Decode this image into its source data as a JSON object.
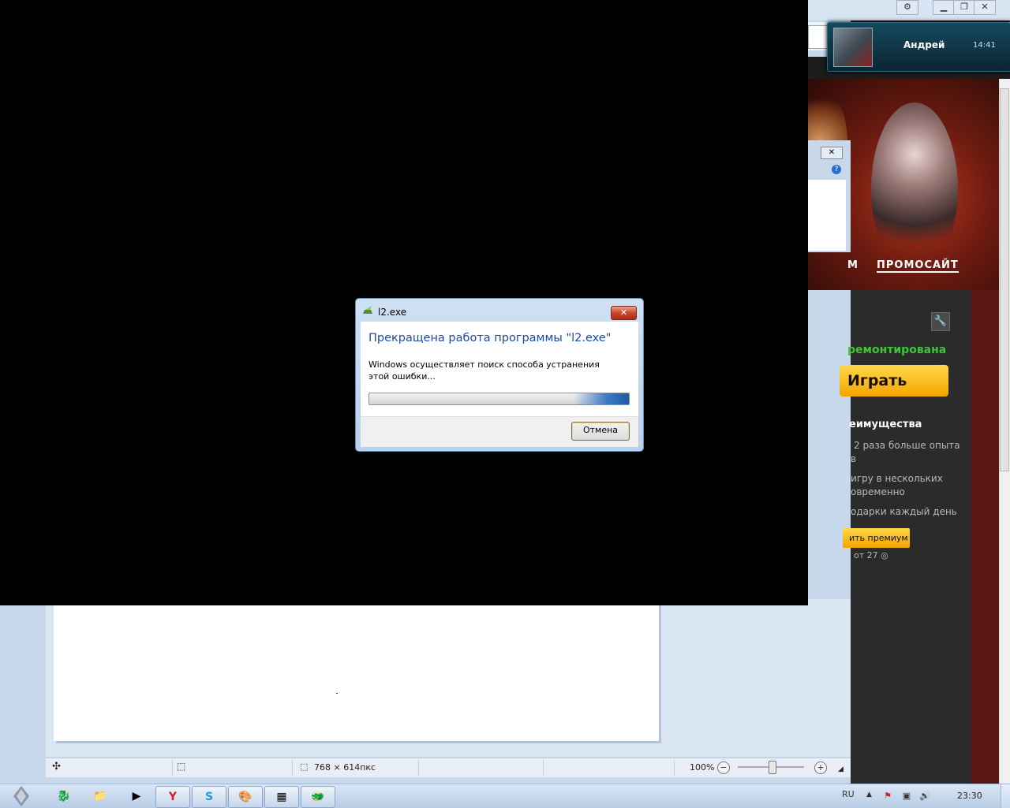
{
  "paint": {
    "status_size": "768 × 614пкс",
    "zoom": "100%",
    "zoom_minus": "−",
    "zoom_plus": "+"
  },
  "launcher": {
    "nav_partial": "М",
    "nav_promo": "ПРОМОСАЙТ",
    "status": "ремонтирована",
    "play_label": "Играть",
    "premium_title": "еимущества",
    "benefits": [
      "2 раза больше опыта",
      "в",
      "игру в нескольких",
      "овременно",
      "одарки каждый день"
    ],
    "premium_button": "ить премиум",
    "premium_price": "от 27 ◎"
  },
  "toast": {
    "name": "Андрей",
    "time": "14:41"
  },
  "dialog": {
    "title": "l2.exe",
    "heading": "Прекращена работа программы \"l2.exe\"",
    "message": "Windows осуществляет поиск способа устранения этой ошибки...",
    "progress_state": "indeterminate",
    "cancel_label": "Отмена",
    "close_label": "✕"
  },
  "taskbar": {
    "language": "RU",
    "clock": "23:30"
  },
  "colors": {
    "dialog_heading": "#1e4aa0",
    "play_button": "#f3a500",
    "status_green": "#3fc43a"
  }
}
